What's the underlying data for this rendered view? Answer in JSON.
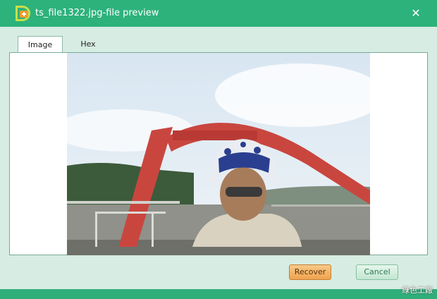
{
  "window": {
    "title": "ts_file1322.jpg-file preview",
    "close_icon": "close-icon",
    "accent_color": "#2db27b"
  },
  "tabs": [
    {
      "label": "Image",
      "active": true
    },
    {
      "label": "Hex",
      "active": false
    }
  ],
  "preview": {
    "image_subject": "photo of a person wearing a motorcycle helmet in front of a red arch bridge"
  },
  "buttons": {
    "recover_label": "Recover",
    "cancel_label": "Cancel"
  },
  "watermark": "綠色工廠"
}
